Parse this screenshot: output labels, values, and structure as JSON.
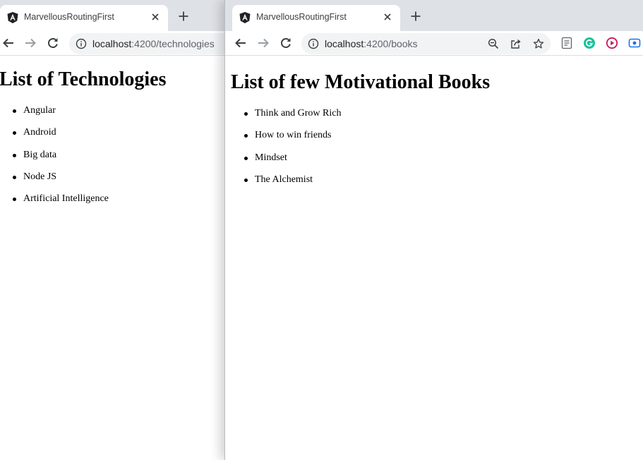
{
  "windows": [
    {
      "tab_title": "MarvellousRoutingFirst",
      "url_host": "localhost",
      "url_path": ":4200/technologies",
      "heading": "List of Technologies",
      "items": [
        "Angular",
        "Android",
        "Big data",
        "Node JS",
        "Artificial Intelligence"
      ]
    },
    {
      "tab_title": "MarvellousRoutingFirst",
      "url_host": "localhost",
      "url_path": ":4200/books",
      "heading": "List of few Motivational Books",
      "items": [
        "Think and Grow Rich",
        "How to win friends",
        "Mindset",
        "The Alchemist"
      ]
    }
  ],
  "icons": {
    "favicon": "angular-logo-icon",
    "close": "close-icon",
    "new_tab": "plus-icon",
    "back": "arrow-left-icon",
    "forward": "arrow-right-icon",
    "reload": "reload-icon",
    "site_info": "info-icon",
    "zoom": "zoom-out-icon",
    "share": "share-icon",
    "bookmark": "star-icon",
    "reader": "reading-mode-icon",
    "grammarly": "grammarly-icon",
    "video_ext": "video-extension-icon",
    "screen_ext": "screen-recorder-icon"
  },
  "colors": {
    "tabstrip": "#dee1e6",
    "omnibox": "#f1f3f4",
    "grammarly": "#15c39a",
    "video_ext": "#c2185b",
    "screen_ext": "#1a73e8"
  }
}
